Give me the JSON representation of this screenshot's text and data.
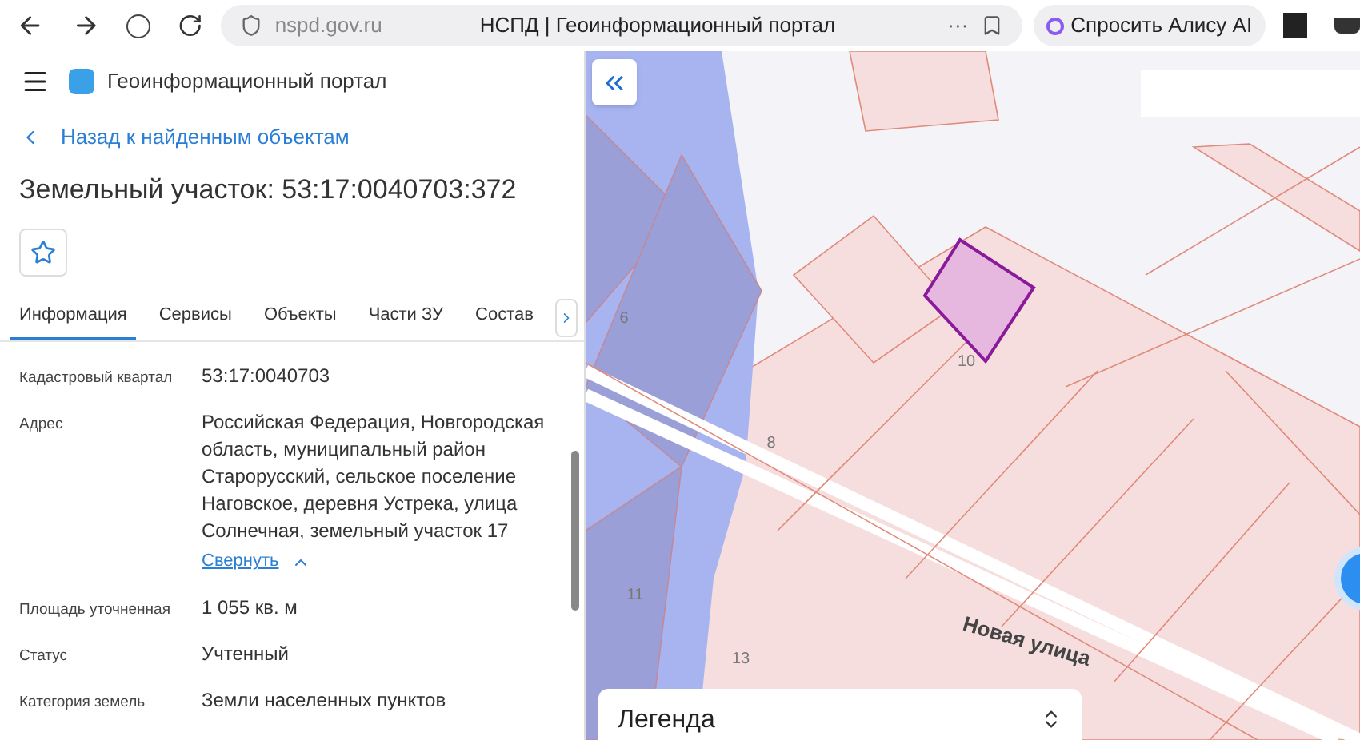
{
  "browser": {
    "url": "nspd.gov.ru",
    "title": "НСПД | Геоинформационный портал",
    "more": "···",
    "assistant_button": "Спросить Алису AI"
  },
  "header": {
    "title": "Геоинформационный портал"
  },
  "back_link": "Назад к найденным объектам",
  "object_title": "Земельный участок: 53:17:0040703:372",
  "tabs": [
    {
      "label": "Информация",
      "selected": true
    },
    {
      "label": "Сервисы",
      "selected": false
    },
    {
      "label": "Объекты",
      "selected": false
    },
    {
      "label": "Части ЗУ",
      "selected": false
    },
    {
      "label": "Состав",
      "selected": false
    }
  ],
  "fields": [
    {
      "label": "Кадастровый квартал",
      "value": "53:17:0040703"
    },
    {
      "label": "Адрес",
      "value": "Российская Федерация, Новгородская область, муниципальный район Старорусский, сельское поселение Наговское, деревня Устрека, улица Солнечная, земельный участок 17",
      "toggle": "Свернуть"
    },
    {
      "label": "Площадь уточненная",
      "value": "1 055 кв. м"
    },
    {
      "label": "Статус",
      "value": "Учтенный"
    },
    {
      "label": "Категория земель",
      "value": "Земли населенных пунктов"
    }
  ],
  "map": {
    "labels": [
      {
        "text": "6",
        "kind": "house"
      },
      {
        "text": "10",
        "kind": "house"
      },
      {
        "text": "8",
        "kind": "house"
      },
      {
        "text": "11",
        "kind": "house"
      },
      {
        "text": "13",
        "kind": "house"
      },
      {
        "text": "Новая улица",
        "kind": "street"
      }
    ],
    "legend": "Легенда"
  }
}
